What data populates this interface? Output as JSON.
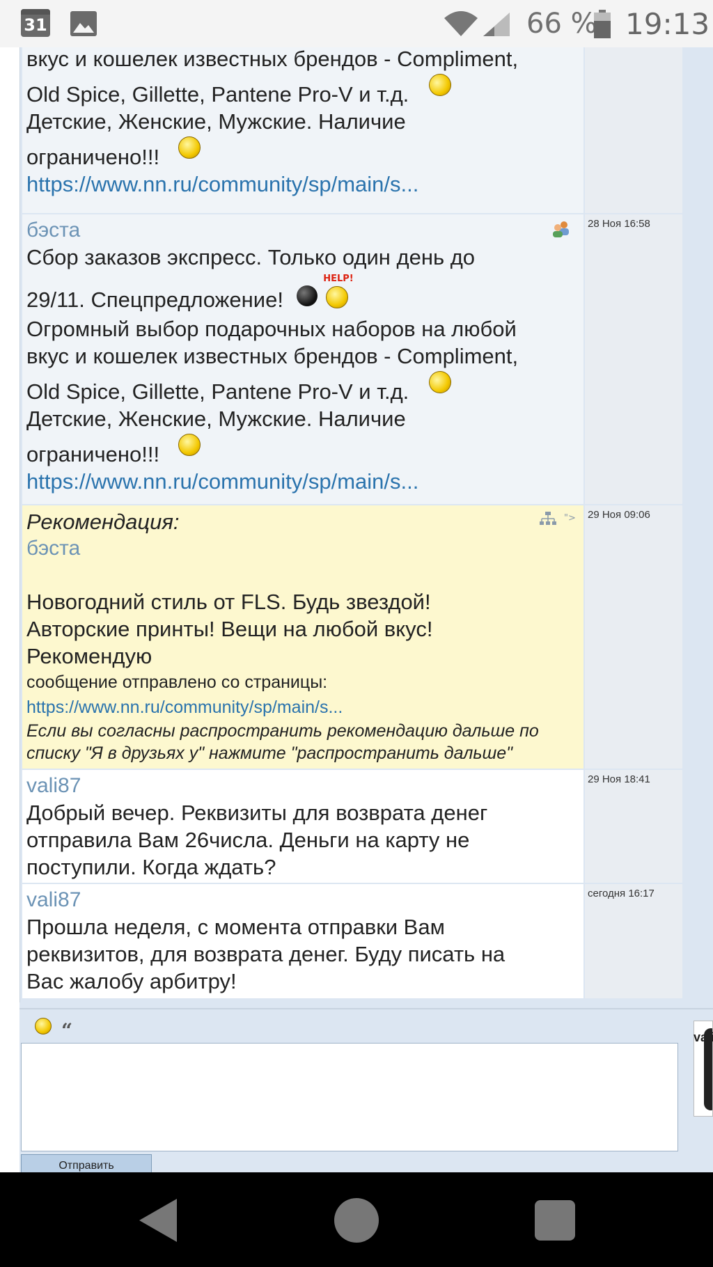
{
  "status_bar": {
    "calendar_day": "31",
    "battery_percent": "66 %",
    "time": "19:13"
  },
  "messages": [
    {
      "id": "m1",
      "author": "",
      "lines": [
        "вкус и кошелек известных брендов - Compliment,",
        "Old Spice, Gillette, Pantene Pro-V и т.д.",
        "Детские, Женские, Мужские. Наличие",
        "ограничено!!!"
      ],
      "link": "https://www.nn.ru/community/sp/main/s...",
      "date": ""
    },
    {
      "id": "m2",
      "author": "бэста",
      "lines": [
        "Сбор заказов экспресс. Только один день до",
        "29/11. Спецпредложение!",
        "Огромный выбор подарочных наборов на любой",
        "вкус и кошелек известных брендов - Compliment,",
        "Old Spice, Gillette, Pantene Pro-V и т.д.",
        "Детские, Женские, Мужские. Наличие",
        "ограничено!!!"
      ],
      "link": "https://www.nn.ru/community/sp/main/s...",
      "date": "28 Ноя 16:58",
      "help_label": "HELP!"
    },
    {
      "id": "m3",
      "heading": "Рекомендация:",
      "author": "бэста",
      "lines": [
        "Новогодний стиль от FLS. Будь звездой!",
        "Авторские принты! Вещи на любой вкус!",
        "Рекомендую"
      ],
      "source_note": "сообщение отправлено со страницы:",
      "link": "https://www.nn.ru/community/sp/main/s...",
      "footer": "Если вы согласны распространить рекомендацию дальше по списку \"Я в друзьях у\" нажмите \"распространить дальше\"",
      "date": "29 Ноя 09:06"
    },
    {
      "id": "m4",
      "author": "vali87",
      "lines": [
        "Добрый вечер. Реквизиты для возврата денег",
        "отправила Вам 26числа. Деньги на карту не",
        "поступили. Когда ждать?"
      ],
      "date": "29 Ноя 18:41"
    },
    {
      "id": "m5",
      "author": "vali87",
      "lines": [
        "Прошла неделя, с момента отправки Вам",
        "реквизитов, для возврата денег. Буду писать на",
        "Вас жалобу арбитру!"
      ],
      "date": "сегодня 16:17"
    }
  ],
  "reply_form": {
    "quote_symbol": "“",
    "textarea_value": "",
    "send_label": "Отправить"
  },
  "side_panel": {
    "name": "vali"
  },
  "colors": {
    "link": "#2a73ad",
    "author": "#6c93b5",
    "recommendation_bg": "#fdf8cf",
    "page_bg": "#dce6f2"
  },
  "icons": {
    "status_bar": [
      "calendar-icon",
      "gallery-icon",
      "wifi-icon",
      "signal-icon",
      "battery-icon"
    ],
    "navigation": [
      "back-icon",
      "home-icon",
      "recents-icon"
    ]
  }
}
